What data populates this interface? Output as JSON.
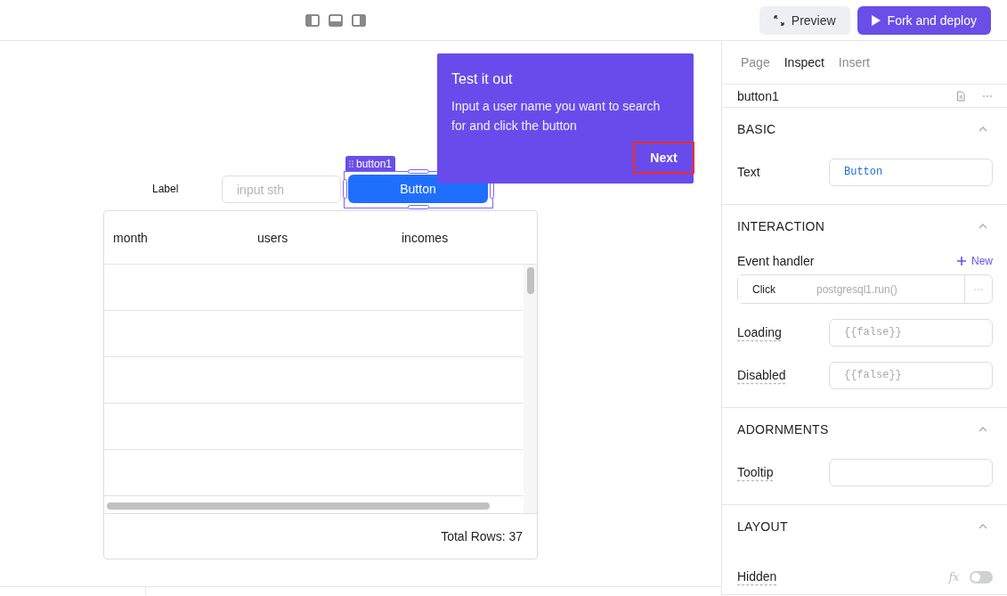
{
  "toolbar": {
    "preview": "Preview",
    "deploy": "Fork and deploy"
  },
  "canvas": {
    "label": "Label",
    "input": {
      "placeholder": "input sth"
    },
    "button": {
      "text": "Button",
      "selected": true,
      "tag": "button1"
    },
    "table": {
      "columns": [
        "month",
        "users",
        "incomes"
      ],
      "footer": "Total Rows: 37"
    }
  },
  "tour": {
    "title": "Test it out",
    "body": "Input a user name you want to search for and click the button",
    "next": "Next"
  },
  "inspector": {
    "tabs": [
      {
        "label": "Page",
        "selected": false
      },
      {
        "label": "Inspect",
        "selected": true
      },
      {
        "label": "Insert",
        "selected": false
      }
    ],
    "component": "button1",
    "sections": [
      {
        "title": "BASIC",
        "expanded": true,
        "fields": [
          {
            "kind": "input",
            "label": "Text",
            "hint": false,
            "value": "Button"
          }
        ]
      },
      {
        "title": "INTERACTION",
        "expanded": true,
        "fields": [
          {
            "kind": "handlers",
            "label": "Event handler",
            "add": "New",
            "handlers": [
              {
                "event": "Click",
                "action": "postgresql1.run()"
              }
            ]
          },
          {
            "kind": "input",
            "label": "Loading",
            "hint": true,
            "placeholder": "{{false}}"
          },
          {
            "kind": "input",
            "label": "Disabled",
            "hint": true,
            "placeholder": "{{false}}"
          }
        ]
      },
      {
        "title": "ADORNMENTS",
        "expanded": true,
        "fields": [
          {
            "kind": "input",
            "label": "Tooltip",
            "hint": true
          }
        ]
      },
      {
        "title": "LAYOUT",
        "expanded": true,
        "fields": [
          {
            "kind": "toggle",
            "label": "Hidden",
            "hint": true,
            "fx": "fx",
            "on": false
          }
        ]
      }
    ]
  }
}
